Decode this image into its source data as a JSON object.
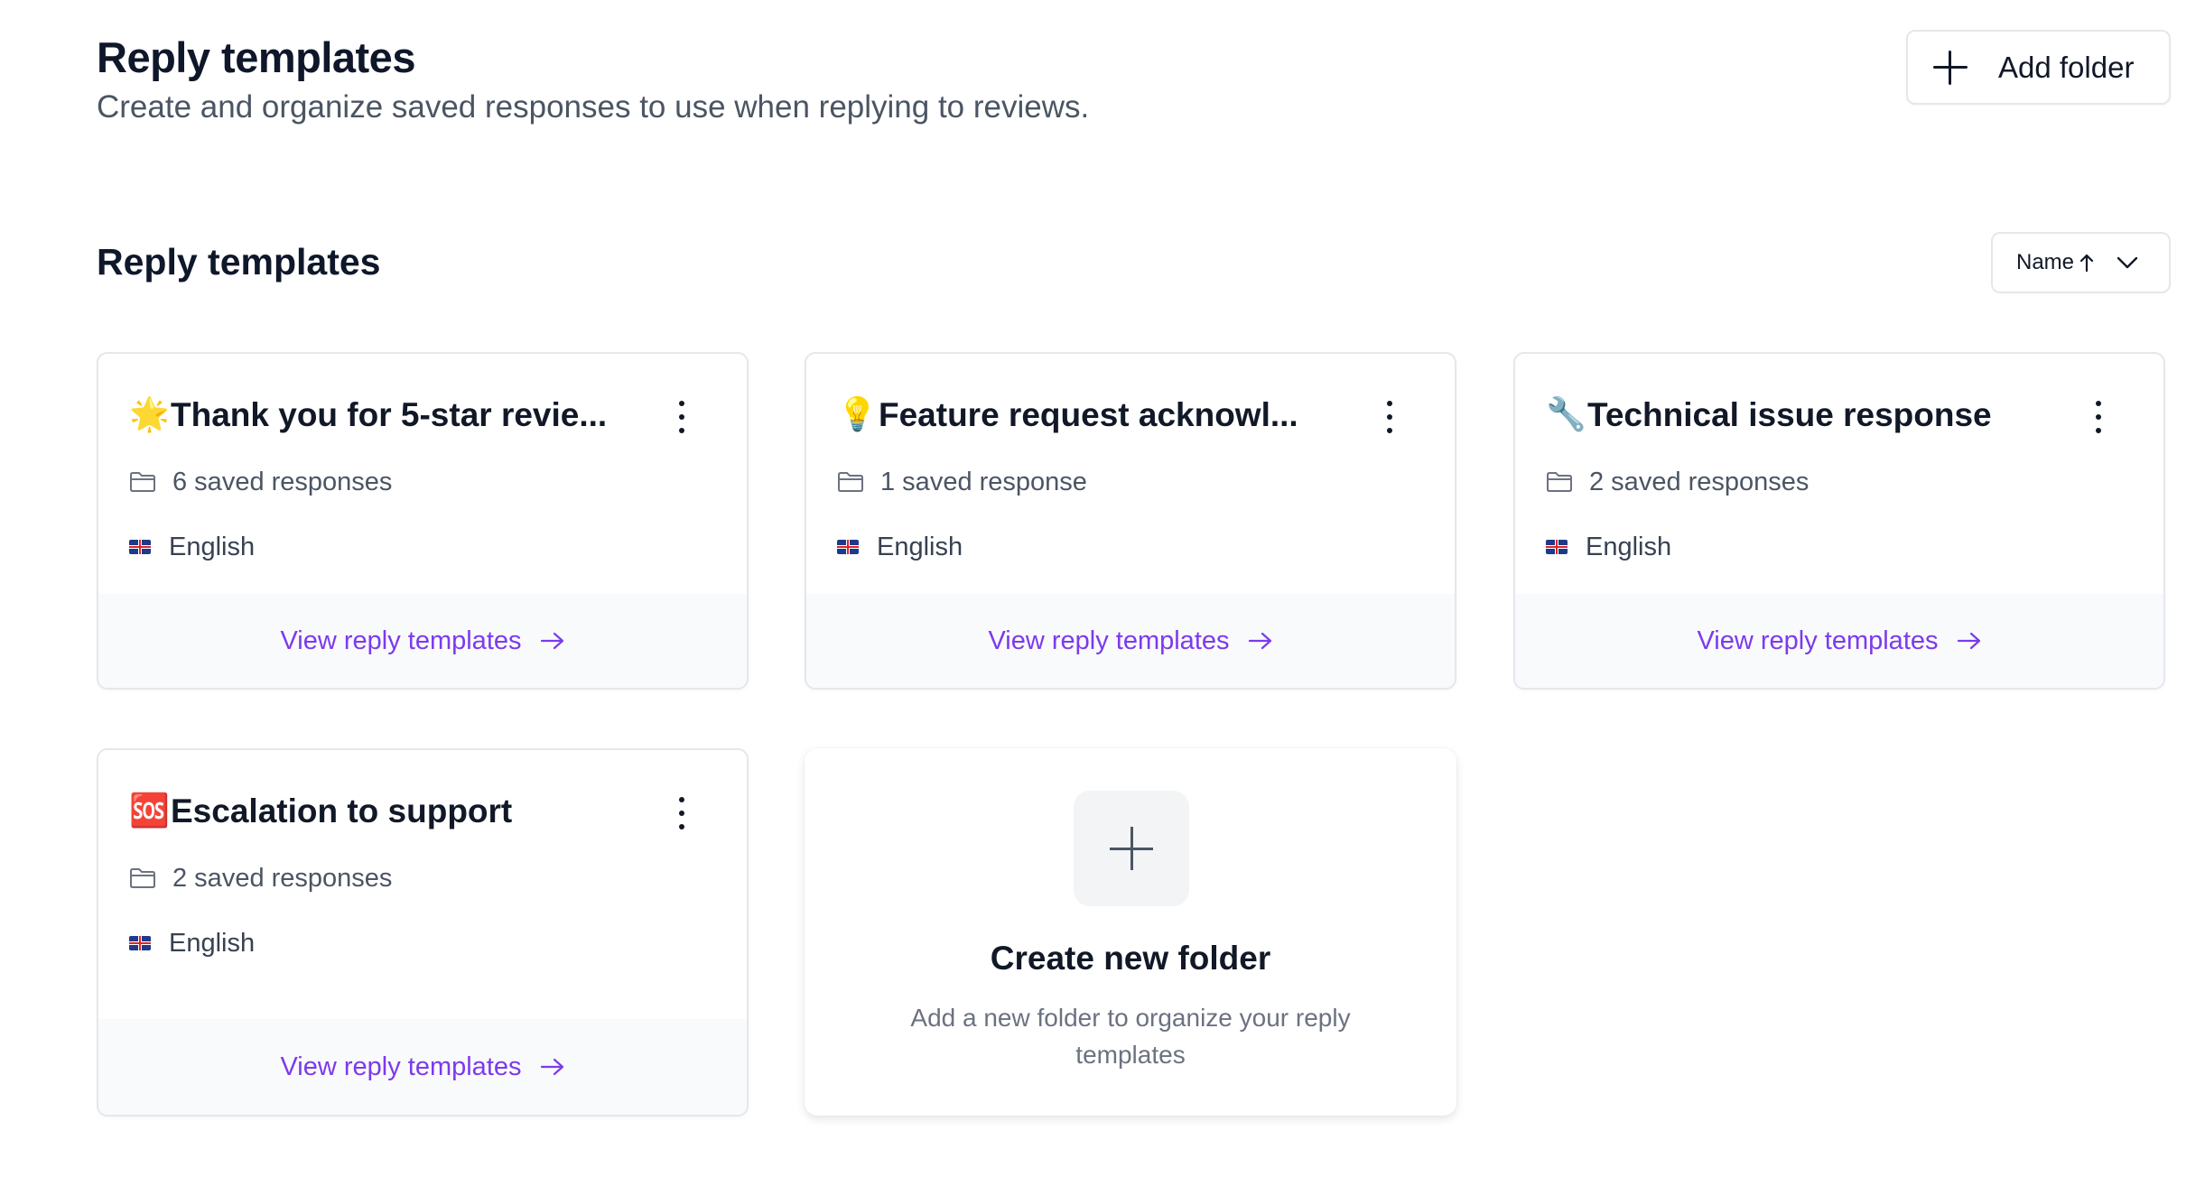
{
  "header": {
    "title": "Reply templates",
    "subtitle": "Create and organize saved responses to use when replying to reviews.",
    "add_folder_label": "Add folder"
  },
  "section": {
    "title": "Reply templates",
    "sort_label": "Name"
  },
  "colors": {
    "link": "#7c3aed",
    "footer_bg": "#f9fafb",
    "border": "#e5e7eb"
  },
  "cards": [
    {
      "emoji": "🌟",
      "title": "Thank you for 5-star revie...",
      "responses": "6 saved responses",
      "language": "English",
      "link": "View reply templates"
    },
    {
      "emoji": "💡",
      "title": "Feature request acknowl...",
      "responses": "1 saved response",
      "language": "English",
      "link": "View reply templates"
    },
    {
      "emoji": "🔧",
      "title": "Technical issue response",
      "responses": "2 saved responses",
      "language": "English",
      "link": "View reply templates"
    },
    {
      "emoji": "🆘",
      "title": "Escalation to support",
      "responses": "2 saved responses",
      "language": "English",
      "link": "View reply templates"
    }
  ],
  "create_card": {
    "title": "Create new folder",
    "description": "Add a new folder to organize your reply templates"
  }
}
